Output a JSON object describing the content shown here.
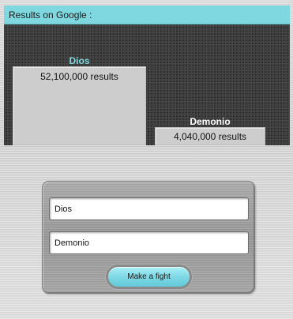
{
  "results": {
    "header": "Results on Google :",
    "bars": [
      {
        "name": "Dios",
        "value_label": "52,100,000 results",
        "value": 52100000
      },
      {
        "name": "Demonio",
        "value_label": "4,040,000 results",
        "value": 4040000
      }
    ]
  },
  "form": {
    "field_1_value": "Dios",
    "field_2_value": "Demonio",
    "button_label": "Make a fight"
  },
  "colors": {
    "accent": "#7fd7e0",
    "panel_bg": "#3a3a3a",
    "bar_fill": "#cdcdcd"
  }
}
